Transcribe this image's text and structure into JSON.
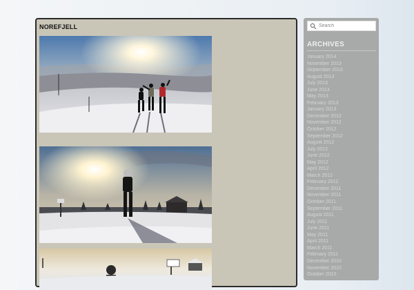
{
  "post": {
    "title": "NOREFJELL"
  },
  "sidebar": {
    "search": {
      "placeholder": "Search"
    },
    "archives": {
      "title": "ARCHIVES",
      "items": [
        "January 2014",
        "November 2013",
        "September 2013",
        "August 2013",
        "July 2013",
        "June 2013",
        "May 2013",
        "February 2013",
        "January 2013",
        "December 2012",
        "November 2012",
        "October 2012",
        "September 2012",
        "August 2012",
        "July 2012",
        "June 2012",
        "May 2012",
        "April 2012",
        "March 2012",
        "February 2012",
        "December 2011",
        "November 2011",
        "October 2011",
        "September 2011",
        "August 2011",
        "July 2011",
        "June 2011",
        "May 2011",
        "April 2011",
        "March 2011",
        "February 2011",
        "December 2010",
        "November 2010",
        "October 2010"
      ]
    }
  },
  "colors": {
    "post_background": "#c9c6b8",
    "sidebar_background": "#a8a9a9",
    "archive_link": "#d6d8d8"
  }
}
